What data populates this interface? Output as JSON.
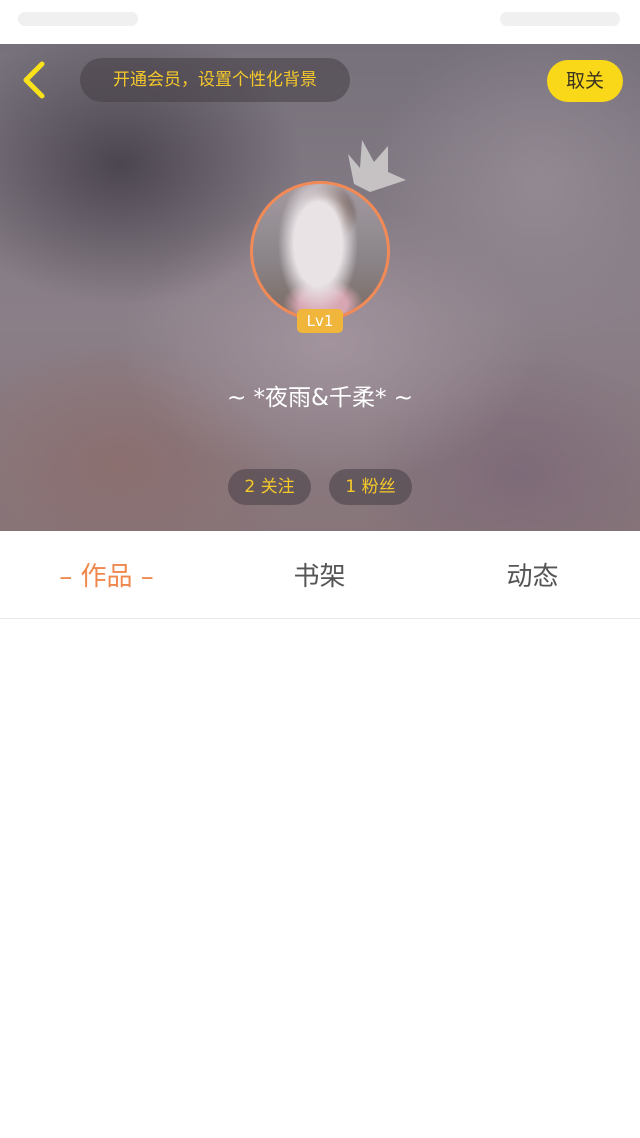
{
  "header": {
    "vip_promo": "开通会员，设置个性化背景",
    "unfollow_label": "取关"
  },
  "profile": {
    "level": "Lv1",
    "username": "~ *夜雨&千柔* ~",
    "following_label": "2 关注",
    "fans_label": "1 粉丝"
  },
  "tabs": [
    {
      "label": "– 作品 –",
      "active": true
    },
    {
      "label": "书架",
      "active": false
    },
    {
      "label": "动态",
      "active": false
    }
  ],
  "colors": {
    "accent_yellow": "#f9d81a",
    "accent_orange": "#f0874c",
    "level_badge": "#f0b53b"
  },
  "icons": {
    "back": "chevron-left-icon",
    "crown": "crown-icon"
  }
}
